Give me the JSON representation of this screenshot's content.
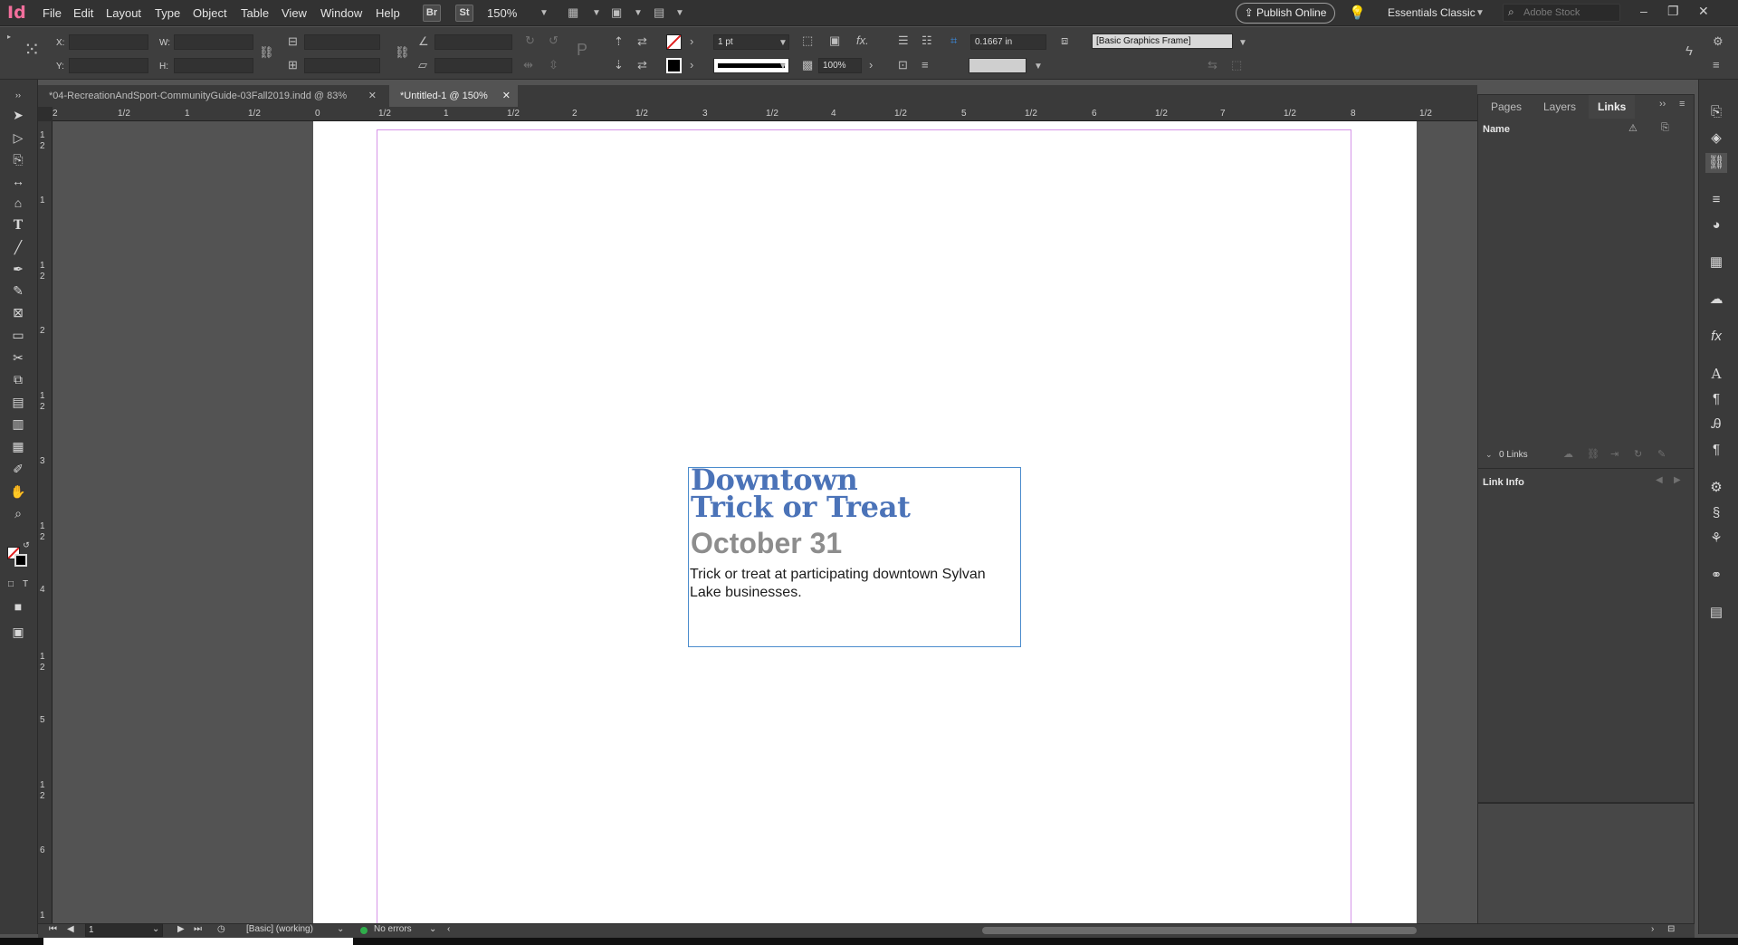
{
  "app": {
    "logo_text": "Id"
  },
  "menu": [
    "File",
    "Edit",
    "Layout",
    "Type",
    "Object",
    "Table",
    "View",
    "Window",
    "Help"
  ],
  "menubar": {
    "bridge_label": "Br",
    "stock_label": "St",
    "zoom": "150%",
    "publish_label": "Publish Online",
    "workspace": "Essentials Classic",
    "search_placeholder": "Adobe Stock"
  },
  "control": {
    "x_label": "X:",
    "y_label": "Y:",
    "w_label": "W:",
    "h_label": "H:",
    "stroke_weight": "1 pt",
    "opacity": "100%",
    "offset": "0.1667 in",
    "object_style": "[Basic Graphics Frame]"
  },
  "tabs": [
    {
      "label": "*04-RecreationAndSport-CommunityGuide-03Fall2019.indd @ 83%",
      "active": false
    },
    {
      "label": "*Untitled-1 @ 150%",
      "active": true
    }
  ],
  "ruler": {
    "h_ticks": [
      "2",
      "1/2",
      "1",
      "1/2",
      "0",
      "1/2",
      "1",
      "1/2",
      "2",
      "1/2",
      "3",
      "1/2",
      "4",
      "1/2",
      "5",
      "1/2",
      "6",
      "1/2",
      "7",
      "1/2",
      "8",
      "1/2"
    ],
    "v_ticks": [
      "1",
      "2",
      "1",
      "1",
      "2",
      "2",
      "1",
      "2",
      "3",
      "1",
      "2",
      "4",
      "1",
      "2",
      "5",
      "1",
      "2",
      "6",
      "1"
    ]
  },
  "document": {
    "headline_1": "Downtown",
    "headline_2": "Trick or Treat",
    "date": "October 31",
    "description": "Trick or treat at participating downtown Sylvan Lake businesses."
  },
  "panel": {
    "tabs": [
      "Pages",
      "Layers",
      "Links"
    ],
    "active_tab": "Links",
    "column_name": "Name",
    "links_count": "0 Links",
    "link_info": "Link Info"
  },
  "status": {
    "page_number": "1",
    "preflight_profile": "[Basic] (working)",
    "errors": "No errors"
  },
  "colors": {
    "headline": "#4b73b8",
    "date": "#8d8d8d",
    "frame_selection": "#4b8ccd",
    "margin_guide": "#d694e8",
    "app_accent": "#f26f9c"
  }
}
